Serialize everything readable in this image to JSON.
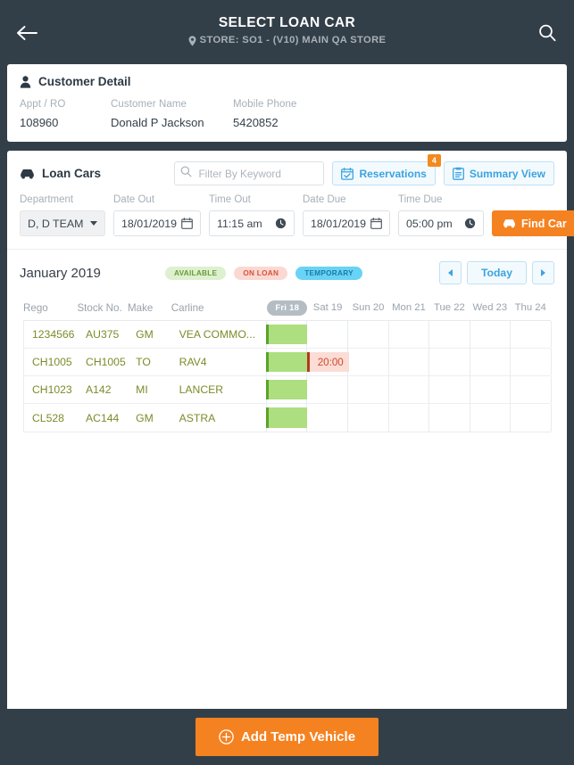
{
  "header": {
    "title": "SELECT LOAN CAR",
    "store": "STORE: SO1 - (V10) MAIN QA STORE",
    "back_icon": "arrow-left-icon",
    "search_icon": "search-icon",
    "pin_icon": "map-pin-icon",
    "background": "#333f48"
  },
  "customer": {
    "section_title": "Customer Detail",
    "icon": "person-icon",
    "fields": [
      {
        "label": "Appt / RO",
        "value": "108960"
      },
      {
        "label": "Customer Name",
        "value": "Donald P Jackson"
      },
      {
        "label": "Mobile Phone",
        "value": "5420852"
      }
    ]
  },
  "loan_cars": {
    "section_title": "Loan Cars",
    "icon": "car-icon",
    "filter": {
      "placeholder": "Filter By Keyword",
      "value": "",
      "icon": "search-icon"
    },
    "reservations": {
      "label": "Reservations",
      "badge": "4",
      "icon": "calendar-check-icon",
      "badge_color": "#f28a1e"
    },
    "summary_view": {
      "label": "Summary View",
      "icon": "clipboard-icon"
    },
    "form": {
      "department": {
        "label": "Department",
        "value": "D, D TEAM"
      },
      "date_out": {
        "label": "Date Out",
        "value": "18/01/2019",
        "icon": "calendar-icon"
      },
      "time_out": {
        "label": "Time Out",
        "value": "11:15 am",
        "icon": "clock-icon"
      },
      "date_due": {
        "label": "Date Due",
        "value": "18/01/2019",
        "icon": "calendar-icon"
      },
      "time_due": {
        "label": "Time Due",
        "value": "05:00 pm",
        "icon": "clock-icon"
      },
      "find_car": {
        "label": "Find Car",
        "icon": "car-icon",
        "color": "#f58220"
      }
    }
  },
  "calendar": {
    "month": "January 2019",
    "legend": [
      {
        "label": "AVAILABLE",
        "bg": "#ddf0cf",
        "fg": "#6d9a3a"
      },
      {
        "label": "ON LOAN",
        "bg": "#fad9d2",
        "fg": "#d9503c"
      },
      {
        "label": "TEMPORARY",
        "bg": "#68d3f5",
        "fg": "#1a7ca8"
      }
    ],
    "nav": {
      "prev_icon": "chevron-left-icon",
      "today_label": "Today",
      "next_icon": "chevron-right-icon"
    },
    "columns": [
      "Rego",
      "Stock No.",
      "Make",
      "Carline"
    ],
    "days": [
      {
        "label": "Fri 18",
        "active": true
      },
      {
        "label": "Sat 19",
        "active": false
      },
      {
        "label": "Sun 20",
        "active": false
      },
      {
        "label": "Mon 21",
        "active": false
      },
      {
        "label": "Tue 22",
        "active": false
      },
      {
        "label": "Wed 23",
        "active": false
      },
      {
        "label": "Thu 24",
        "active": false
      }
    ],
    "rows": [
      {
        "rego": "1234566",
        "stock": "AU375",
        "make": "GM",
        "carline": "VEA COMMO...",
        "bars": [
          {
            "type": "available",
            "start_day": 0,
            "span": 1,
            "label": ""
          }
        ]
      },
      {
        "rego": "CH1005",
        "stock": "CH1005",
        "make": "TO",
        "carline": "RAV4",
        "bars": [
          {
            "type": "available",
            "start_day": 0,
            "span": 1,
            "label": ""
          },
          {
            "type": "onloan",
            "start_day": 1,
            "span": 1,
            "label": "20:00"
          }
        ]
      },
      {
        "rego": "CH1023",
        "stock": "A142",
        "make": "MI",
        "carline": "LANCER",
        "bars": [
          {
            "type": "available",
            "start_day": 0,
            "span": 1,
            "label": ""
          }
        ]
      },
      {
        "rego": "CL528",
        "stock": "AC144",
        "make": "GM",
        "carline": "ASTRA",
        "bars": [
          {
            "type": "available",
            "start_day": 0,
            "span": 1,
            "label": ""
          }
        ]
      }
    ]
  },
  "footer": {
    "add_temp_vehicle": {
      "label": "Add Temp Vehicle",
      "icon": "plus-circle-icon",
      "color": "#f58220"
    }
  }
}
